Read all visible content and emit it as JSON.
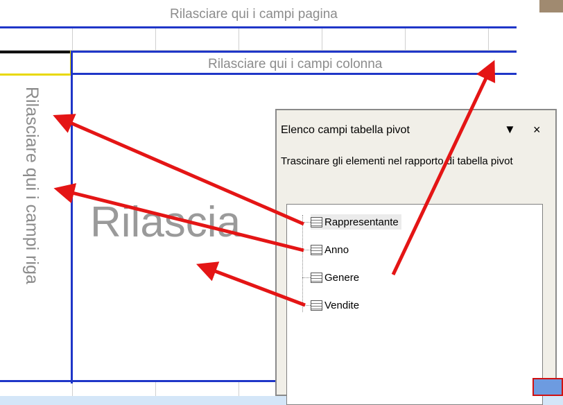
{
  "pivot_layout": {
    "page_drop_zone": "Rilasciare qui i campi pagina",
    "column_drop_zone": "Rilasciare qui i campi colonna",
    "row_drop_zone": "Rilasciare qui i campi riga",
    "data_drop_zone": "Rilascia"
  },
  "field_list": {
    "title": "Elenco campi tabella pivot",
    "dropdown_icon": "▼",
    "close_icon": "×",
    "instructions": "Trascinare gli elementi nel rapporto di tabella pivot",
    "fields": [
      {
        "label": "Rappresentante",
        "selected": true
      },
      {
        "label": "Anno",
        "selected": false
      },
      {
        "label": "Genere",
        "selected": false
      },
      {
        "label": "Vendite",
        "selected": false
      }
    ]
  },
  "colors": {
    "zone_border": "#1f36c8",
    "arrow": "#e41515",
    "drop_text": "#8c8c8c",
    "background": "#d4e6f8"
  }
}
